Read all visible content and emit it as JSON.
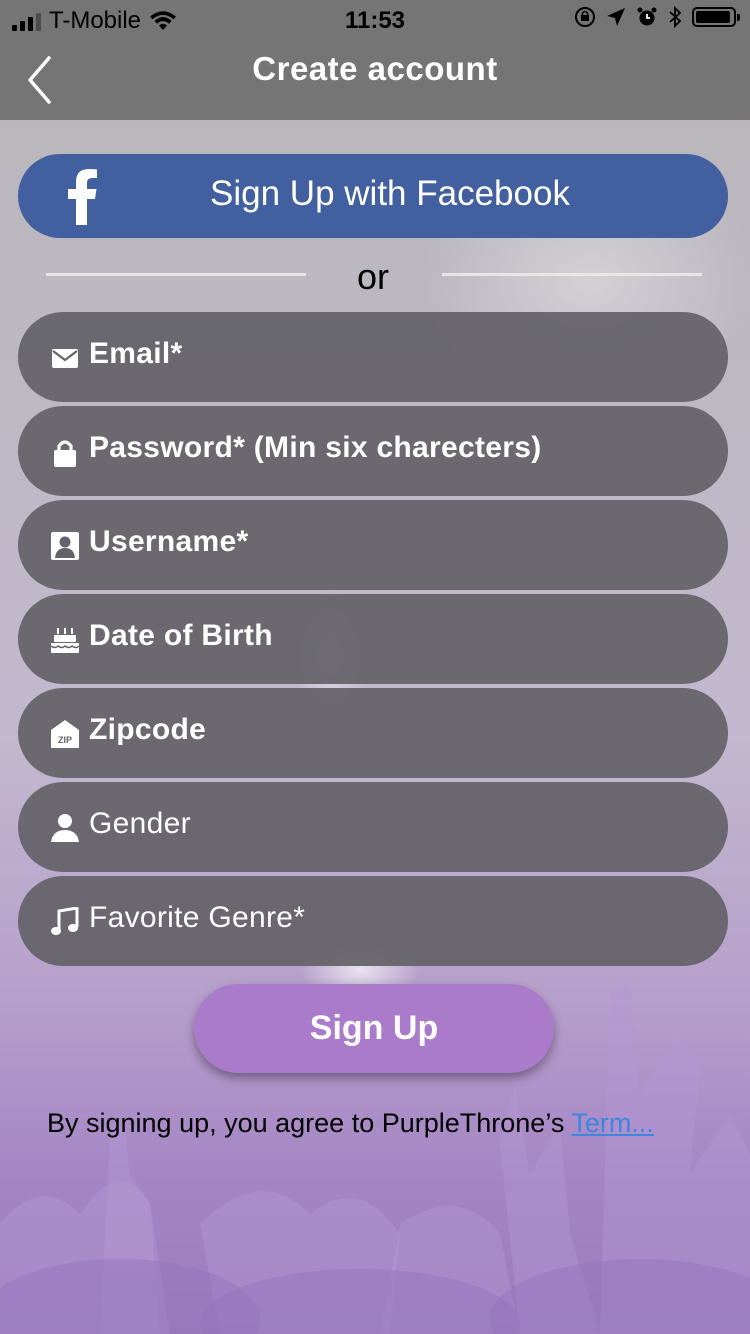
{
  "status_bar": {
    "carrier": "T-Mobile",
    "time": "11:53",
    "icons": [
      "signal-icon",
      "wifi-icon",
      "orientation-lock-icon",
      "location-icon",
      "alarm-icon",
      "bluetooth-icon",
      "battery-icon"
    ]
  },
  "nav": {
    "title": "Create account",
    "back_icon": "chevron-left-icon"
  },
  "facebook": {
    "label": "Sign Up with Facebook",
    "icon": "facebook-icon",
    "color": "#42609f"
  },
  "divider": {
    "text": "or"
  },
  "fields": {
    "email": {
      "placeholder": "Email*",
      "icon": "envelope-icon"
    },
    "password": {
      "placeholder": "Password* (Min six charecters)",
      "icon": "lock-icon"
    },
    "username": {
      "placeholder": "Username*",
      "icon": "user-card-icon"
    },
    "dob": {
      "placeholder": "Date of Birth",
      "icon": "cake-icon"
    },
    "zipcode": {
      "placeholder": "Zipcode",
      "icon": "zip-house-icon"
    },
    "gender": {
      "placeholder": "Gender",
      "icon": "person-icon"
    },
    "genre": {
      "placeholder": "Favorite Genre*",
      "icon": "music-note-icon"
    }
  },
  "signup": {
    "label": "Sign Up",
    "color": "#a97bca"
  },
  "terms": {
    "text": "By signing up, you agree to PurpleThrone’s ",
    "link": "Term..."
  },
  "colors": {
    "bar": "#757575",
    "field": "#646268",
    "link": "#3b87e0"
  }
}
